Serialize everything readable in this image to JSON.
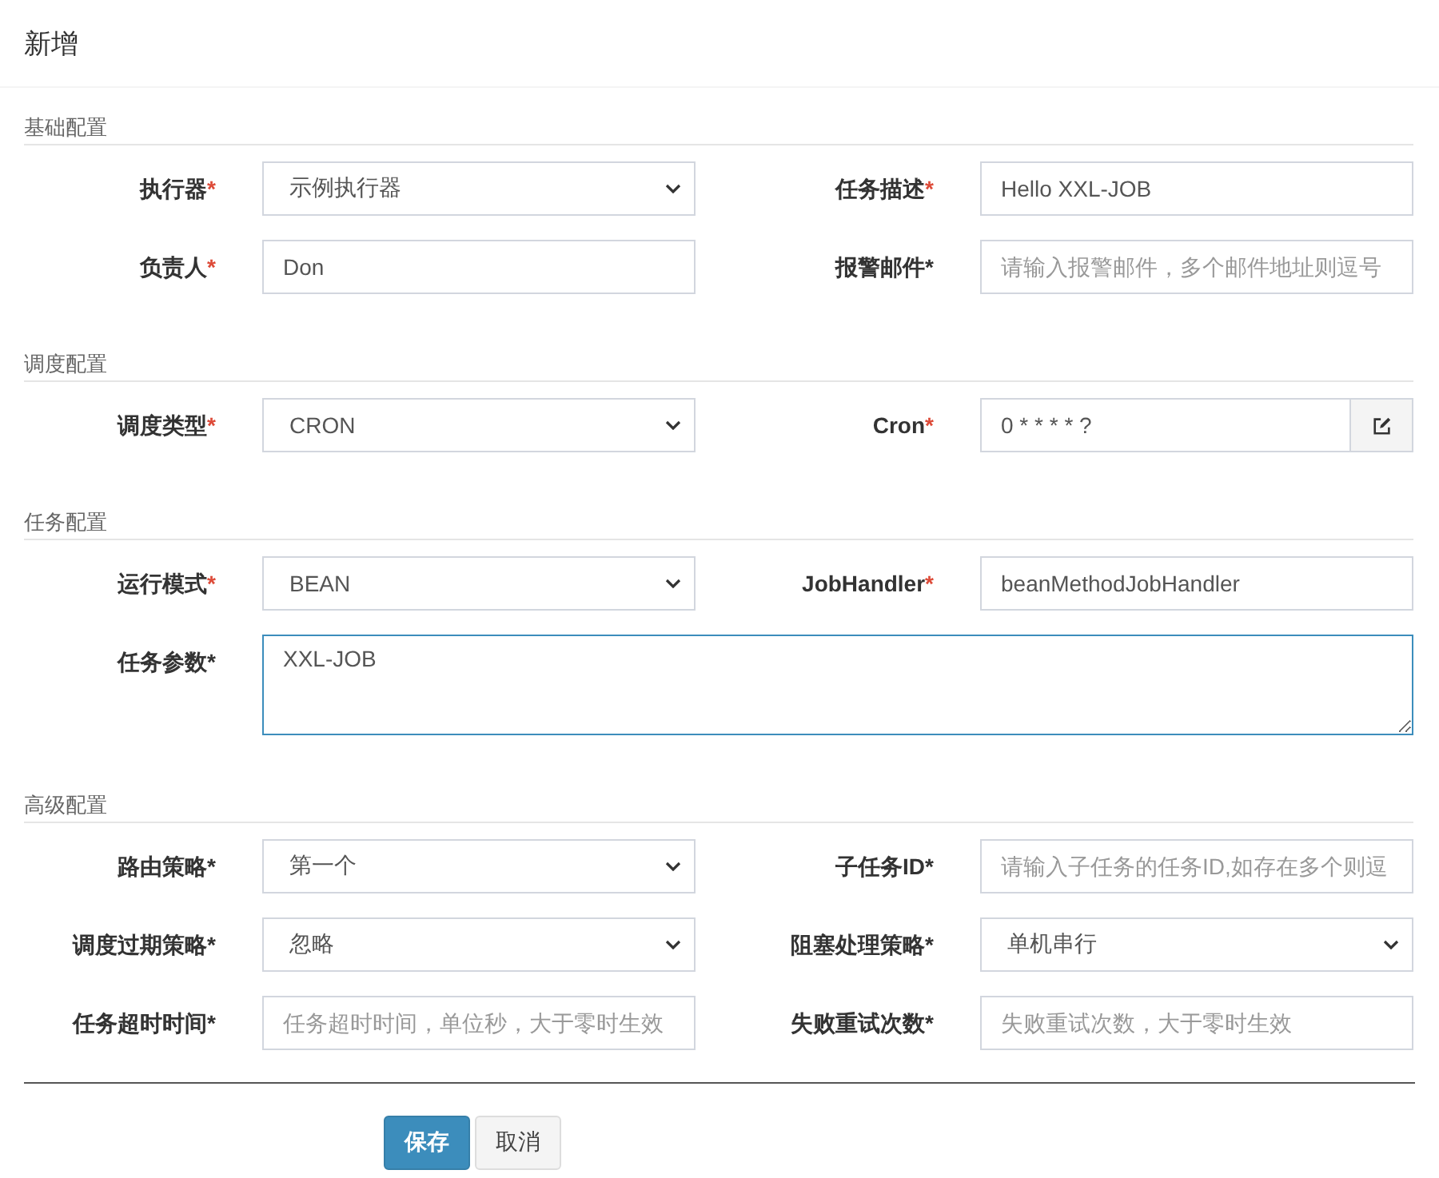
{
  "dialog": {
    "title": "新增"
  },
  "sections": [
    {
      "title": "基础配置",
      "fields": [
        {
          "kind": "select",
          "label": "执行器",
          "mark": "*",
          "mark_highlighted": true,
          "focused": false,
          "value": "示例执行器"
        },
        {
          "kind": "text",
          "label": "任务描述",
          "mark": "*",
          "mark_highlighted": true,
          "focused": false,
          "value": "Hello XXL-JOB"
        },
        {
          "kind": "text",
          "label": "负责人",
          "mark": "*",
          "mark_highlighted": true,
          "focused": false,
          "value": "Don"
        },
        {
          "kind": "text",
          "label": "报警邮件",
          "mark": "*",
          "mark_highlighted": false,
          "focused": false,
          "placeholder": "请输入报警邮件，多个邮件地址则逗号"
        }
      ]
    },
    {
      "title": "调度配置",
      "fields": [
        {
          "kind": "select",
          "label": "调度类型",
          "mark": "*",
          "mark_highlighted": true,
          "focused": false,
          "value": "CRON"
        },
        {
          "kind": "text_button",
          "label": "Cron",
          "mark": "*",
          "mark_highlighted": true,
          "focused": false,
          "value": "0 * * * * ?"
        }
      ]
    },
    {
      "title": "任务配置",
      "fields": [
        {
          "kind": "select",
          "label": "运行模式",
          "mark": "*",
          "mark_highlighted": true,
          "focused": false,
          "value": "BEAN"
        },
        {
          "kind": "text",
          "label": "JobHandler",
          "mark": "*",
          "mark_highlighted": true,
          "focused": false,
          "value": "beanMethodJobHandler"
        },
        {
          "kind": "textarea",
          "label": "任务参数",
          "mark": "*",
          "mark_highlighted": false,
          "focused": true,
          "value": "XXL-JOB"
        }
      ]
    },
    {
      "title": "高级配置",
      "fields": [
        {
          "kind": "select",
          "label": "路由策略",
          "mark": "*",
          "mark_highlighted": false,
          "focused": false,
          "value": "第一个"
        },
        {
          "kind": "text",
          "label": "子任务ID",
          "mark": "*",
          "mark_highlighted": false,
          "focused": false,
          "placeholder": "请输入子任务的任务ID,如存在多个则逗"
        },
        {
          "kind": "select",
          "label": "调度过期策略",
          "mark": "*",
          "mark_highlighted": false,
          "focused": false,
          "value": "忽略"
        },
        {
          "kind": "select",
          "label": "阻塞处理策略",
          "mark": "*",
          "mark_highlighted": false,
          "focused": false,
          "value": "单机串行"
        },
        {
          "kind": "text",
          "label": "任务超时时间",
          "mark": "*",
          "mark_highlighted": false,
          "focused": false,
          "placeholder": "任务超时时间，单位秒，大于零时生效"
        },
        {
          "kind": "text",
          "label": "失败重试次数",
          "mark": "*",
          "mark_highlighted": false,
          "focused": false,
          "placeholder": "失败重试次数，大于零时生效"
        }
      ]
    }
  ],
  "buttons": [
    {
      "kind": "primary",
      "label": "保存"
    },
    {
      "kind": "default",
      "label": "取消"
    }
  ]
}
